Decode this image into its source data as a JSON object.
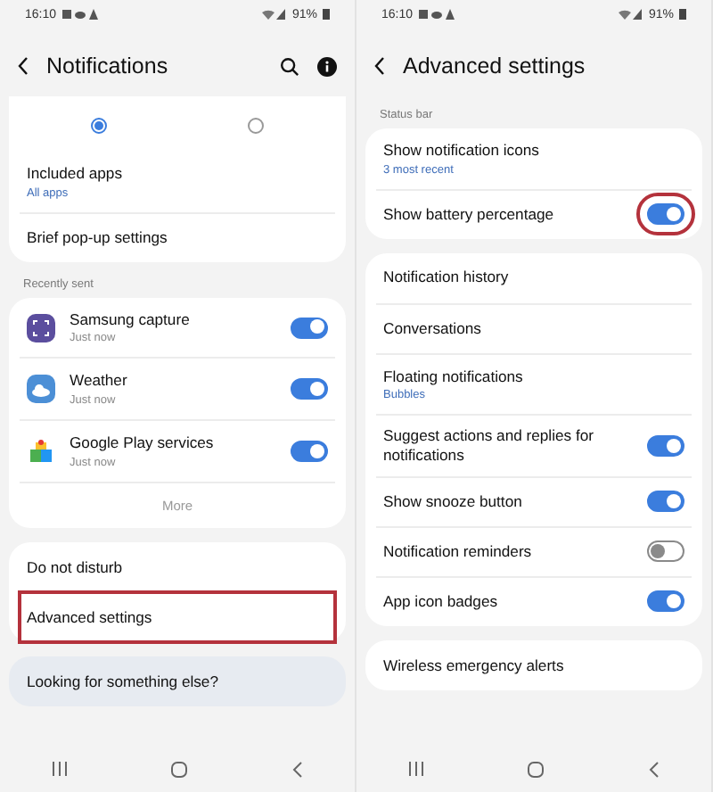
{
  "screens": [
    {
      "status_bar": {
        "time": "16:10",
        "battery": "91%"
      },
      "header": {
        "title": "Notifications",
        "actions": [
          {
            "kind": "search"
          },
          {
            "kind": "info"
          }
        ]
      },
      "groups": [
        {
          "kind": "card",
          "items": [
            {
              "kind": "radios",
              "options": [
                {
                  "selected": true
                },
                {
                  "selected": false
                }
              ]
            },
            {
              "kind": "row",
              "title": "Included apps",
              "subtitle": "All apps",
              "highlighted": false
            },
            {
              "kind": "row",
              "title": "Brief pop-up settings",
              "highlighted": false
            }
          ]
        },
        {
          "kind": "card",
          "label": "Recently sent",
          "items": [
            {
              "kind": "app",
              "title": "Samsung capture",
              "subtitle": "Just now",
              "on": true,
              "highlighted": false
            },
            {
              "kind": "app",
              "title": "Weather",
              "subtitle": "Just now",
              "on": true,
              "highlighted": false
            },
            {
              "kind": "app",
              "title": "Google Play services",
              "subtitle": "Just now",
              "on": true,
              "highlighted": false
            },
            {
              "kind": "more",
              "title": "More"
            }
          ]
        },
        {
          "kind": "card",
          "items": [
            {
              "kind": "row",
              "title": "Do not disturb",
              "highlighted": false
            },
            {
              "kind": "row",
              "title": "Advanced settings",
              "highlighted": true
            }
          ]
        },
        {
          "kind": "suggestion",
          "items": [
            {
              "kind": "row",
              "title": "Looking for something else?",
              "highlighted": false
            }
          ]
        }
      ]
    },
    {
      "status_bar": {
        "time": "16:10",
        "battery": "91%"
      },
      "header": {
        "title": "Advanced settings"
      },
      "groups": [
        {
          "kind": "card",
          "label": "Status bar",
          "items": [
            {
              "kind": "row",
              "title": "Show notification icons",
              "subtitle": "3 most recent",
              "highlighted": false
            },
            {
              "kind": "row",
              "title": "Show battery percentage",
              "on": true,
              "highlighted": true
            }
          ]
        },
        {
          "kind": "card",
          "items": [
            {
              "kind": "row",
              "title": "Notification history",
              "highlighted": false
            },
            {
              "kind": "row",
              "title": "Conversations",
              "highlighted": false
            },
            {
              "kind": "row",
              "title": "Floating notifications",
              "subtitle": "Bubbles",
              "highlighted": false
            },
            {
              "kind": "row",
              "title": "Suggest actions and replies for notifications",
              "on": true,
              "highlighted": false
            },
            {
              "kind": "row",
              "title": "Show snooze button",
              "on": true,
              "highlighted": false
            },
            {
              "kind": "row",
              "title": "Notification reminders",
              "on": false,
              "highlighted": false
            },
            {
              "kind": "row",
              "title": "App icon badges",
              "on": true,
              "highlighted": false
            }
          ]
        },
        {
          "kind": "card",
          "items": [
            {
              "kind": "row",
              "title": "Wireless emergency alerts",
              "highlighted": false
            }
          ]
        }
      ]
    }
  ]
}
